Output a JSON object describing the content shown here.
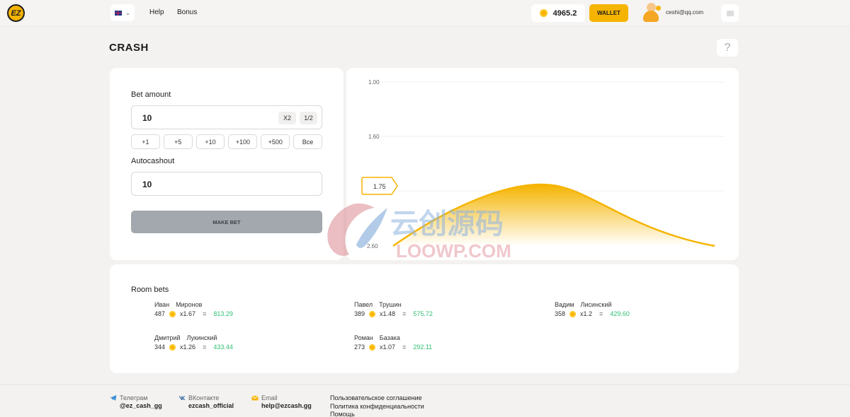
{
  "header": {
    "logo_text": "EZ",
    "nav": [
      "Help",
      "Bonus"
    ],
    "balance": "4965.2",
    "wallet_label": "WALLET",
    "user_email": "ceshi@qq.com"
  },
  "page": {
    "title": "CRASH",
    "help_glyph": "?"
  },
  "bet": {
    "amount_label": "Bet amount",
    "amount_value": "10",
    "x2_label": "X2",
    "half_label": "1/2",
    "quick": [
      "+1",
      "+5",
      "+10",
      "+100",
      "+500",
      "Все"
    ],
    "autocashout_label": "Autocashout",
    "autocashout_value": "10",
    "make_bet_label": "MAKE BET"
  },
  "graph": {
    "y_labels": [
      "1.00",
      "1.60",
      "2.60"
    ],
    "current_multiplier": "1.75",
    "curve_color": "#f5b400"
  },
  "room": {
    "title": "Room bets",
    "bets": [
      {
        "first": "Иван",
        "last": "Миронов",
        "amount": "487",
        "mult": "x1.67",
        "eq": "=",
        "win": "813.29"
      },
      {
        "first": "Павел",
        "last": "Трушин",
        "amount": "389",
        "mult": "x1.48",
        "eq": "=",
        "win": "575.72"
      },
      {
        "first": "Вадим",
        "last": "Лисинский",
        "amount": "358",
        "mult": "x1.2",
        "eq": "=",
        "win": "429.60"
      },
      {
        "first": "Дмитрий",
        "last": "Лукинский",
        "amount": "344",
        "mult": "x1.26",
        "eq": "=",
        "win": "433.44"
      },
      {
        "first": "Роман",
        "last": "Базака",
        "amount": "273",
        "mult": "x1.07",
        "eq": "=",
        "win": "292.11"
      }
    ]
  },
  "footer": {
    "telegram": {
      "label": "Телеграм",
      "value": "@ez_cash_gg"
    },
    "vk": {
      "label": "ВКонтакте",
      "value": "ezcash_official"
    },
    "email": {
      "label": "Email",
      "value": "help@ezcash.gg"
    },
    "links": [
      "Пользовательское соглашение",
      "Политика конфиденциальности",
      "Помощь"
    ]
  },
  "watermark": {
    "cn": "云创源码",
    "en": "LOOWP.COM"
  },
  "colors": {
    "accent": "#f5b400",
    "win": "#2fbf71",
    "disabled_button": "#a3a7ae"
  }
}
